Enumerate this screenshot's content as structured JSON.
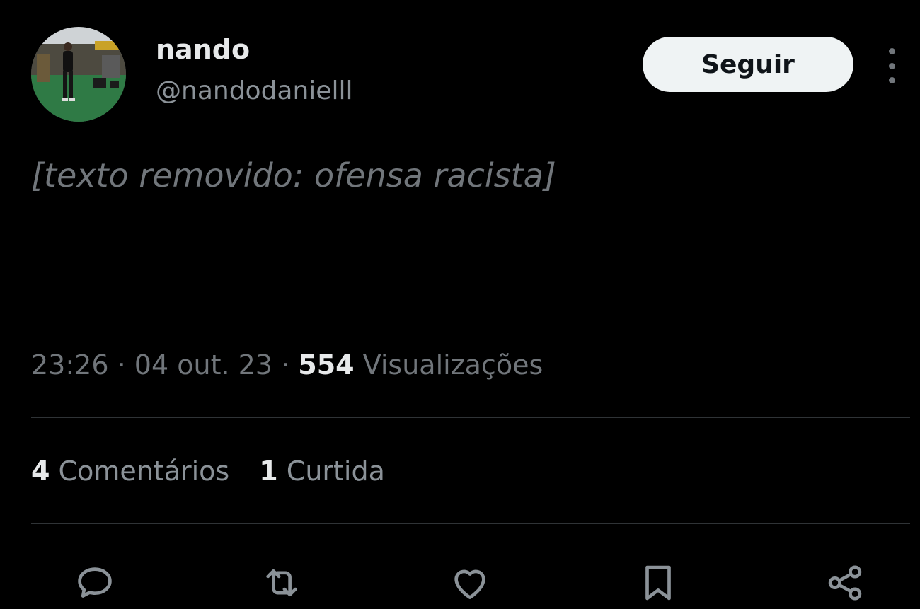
{
  "author": {
    "display_name": "nando",
    "handle": "@nandodanielll"
  },
  "follow_label": "Seguir",
  "post": {
    "text": "[texto removido: ofensa racista]"
  },
  "meta": {
    "time": "23:26",
    "separator": "·",
    "date": "04 out. 23",
    "views_count": "554",
    "views_label": "Visualizações"
  },
  "stats": {
    "comments_count": "4",
    "comments_label": "Comentários",
    "likes_count": "1",
    "likes_label": "Curtida"
  },
  "icons": [
    "comment-icon",
    "repost-icon",
    "like-icon",
    "bookmark-icon",
    "share-icon",
    "more-icon"
  ],
  "colors": {
    "background": "#000000",
    "text": "#e7e9ea",
    "muted": "#71767b",
    "button": "#eff3f4",
    "divider": "#2f3336"
  }
}
